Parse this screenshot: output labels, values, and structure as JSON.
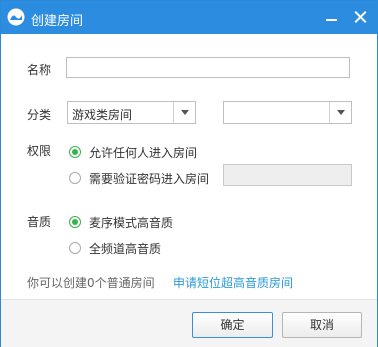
{
  "window": {
    "title": "创建房间"
  },
  "form": {
    "name_label": "名称",
    "name_value": "",
    "category_label": "分类",
    "category_value": "游戏类房间",
    "subcategory_value": "",
    "permission_label": "权限",
    "permission_options": [
      "允许任何人进入房间",
      "需要验证密码进入房间"
    ],
    "permission_selected": 0,
    "password_value": "",
    "quality_label": "音质",
    "quality_options": [
      "麦序模式高音质",
      "全频道高音质"
    ],
    "quality_selected": 0
  },
  "info": {
    "text": "你可以创建0个普通房间",
    "link": "申请短位超高音质房间"
  },
  "footer": {
    "confirm_label": "确定",
    "cancel_label": "取消"
  },
  "colors": {
    "titlebar": "#2c8ce0",
    "link": "#2b9ad8",
    "radio_on": "#37b24d"
  }
}
